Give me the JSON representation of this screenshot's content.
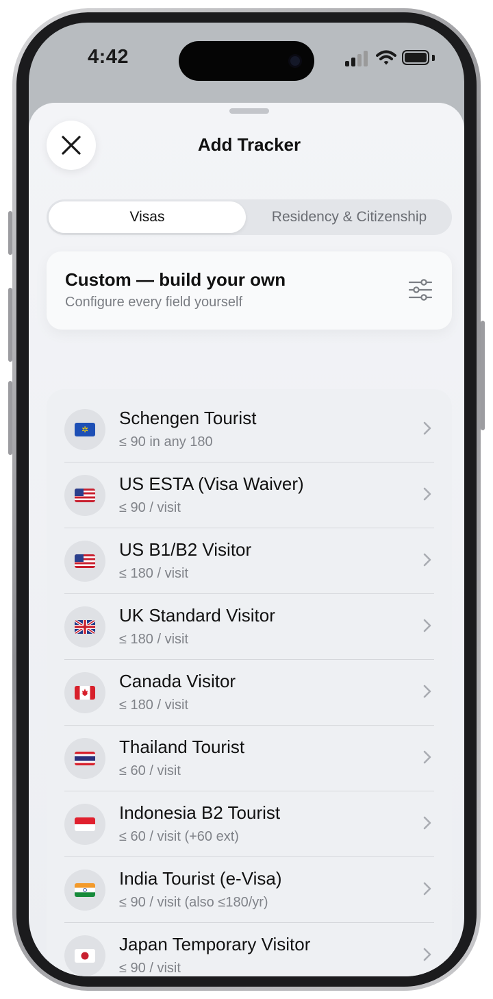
{
  "status_bar": {
    "time": "4:42"
  },
  "sheet": {
    "title": "Add Tracker"
  },
  "tabs": [
    {
      "label": "Visas",
      "selected": true
    },
    {
      "label": "Residency & Citizenship",
      "selected": false
    }
  ],
  "custom": {
    "title": "Custom — build your own",
    "subtitle": "Configure every field yourself",
    "icon": "sliders-icon"
  },
  "trackers": [
    {
      "title": "Schengen Tourist",
      "rule": "≤ 90 in any 180",
      "flag": "eu"
    },
    {
      "title": "US ESTA (Visa Waiver)",
      "rule": "≤ 90 / visit",
      "flag": "us"
    },
    {
      "title": "US B1/B2 Visitor",
      "rule": "≤ 180 / visit",
      "flag": "us"
    },
    {
      "title": "UK Standard Visitor",
      "rule": "≤ 180 / visit",
      "flag": "uk"
    },
    {
      "title": "Canada Visitor",
      "rule": "≤ 180 / visit",
      "flag": "ca"
    },
    {
      "title": "Thailand Tourist",
      "rule": "≤ 60 / visit",
      "flag": "th"
    },
    {
      "title": "Indonesia B2 Tourist",
      "rule": "≤ 60 / visit (+60 ext)",
      "flag": "id"
    },
    {
      "title": "India Tourist (e-Visa)",
      "rule": "≤ 90 / visit (also ≤180/yr)",
      "flag": "in"
    },
    {
      "title": "Japan Temporary Visitor",
      "rule": "≤ 90 / visit",
      "flag": "jp"
    }
  ]
}
